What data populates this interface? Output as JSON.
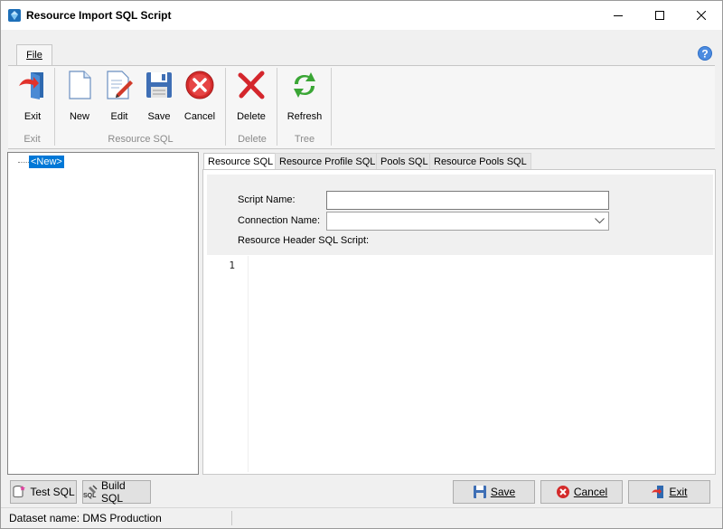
{
  "window": {
    "title": "Resource Import SQL Script",
    "icons": {
      "app": "app-diamond-icon",
      "minimize": "minimize-icon",
      "maximize": "maximize-icon",
      "close": "close-icon"
    }
  },
  "ribbon": {
    "tab": "File",
    "help_icon": "help-icon",
    "buttons": {
      "exit": "Exit",
      "new": "New",
      "edit": "Edit",
      "save": "Save",
      "cancel": "Cancel",
      "delete": "Delete",
      "refresh": "Refresh"
    },
    "groups": {
      "exit": "Exit",
      "resource_sql": "Resource SQL",
      "delete": "Delete",
      "tree": "Tree"
    }
  },
  "tree": {
    "items": [
      {
        "label": "<New>",
        "selected": true
      }
    ]
  },
  "tabs": [
    {
      "label": "Resource SQL",
      "active": true
    },
    {
      "label": "Resource Profile SQL",
      "active": false
    },
    {
      "label": "Pools SQL",
      "active": false
    },
    {
      "label": "Resource Pools SQL",
      "active": false
    }
  ],
  "form": {
    "script_name_label": "Script Name:",
    "script_name_value": "",
    "connection_name_label": "Connection Name:",
    "connection_name_value": "",
    "header_label": "Resource Header SQL Script:"
  },
  "editor": {
    "line_numbers": [
      "1"
    ]
  },
  "bottom": {
    "test_sql": "Test SQL",
    "build_sql": "Build SQL",
    "save": "Save",
    "cancel": "Cancel",
    "exit": "Exit"
  },
  "status": {
    "dataset": "Dataset name:  DMS Production"
  },
  "colors": {
    "selection": "#0078d7",
    "delete_red": "#d4262c",
    "refresh_green": "#3aa635",
    "save_blue": "#3f6fb5"
  }
}
